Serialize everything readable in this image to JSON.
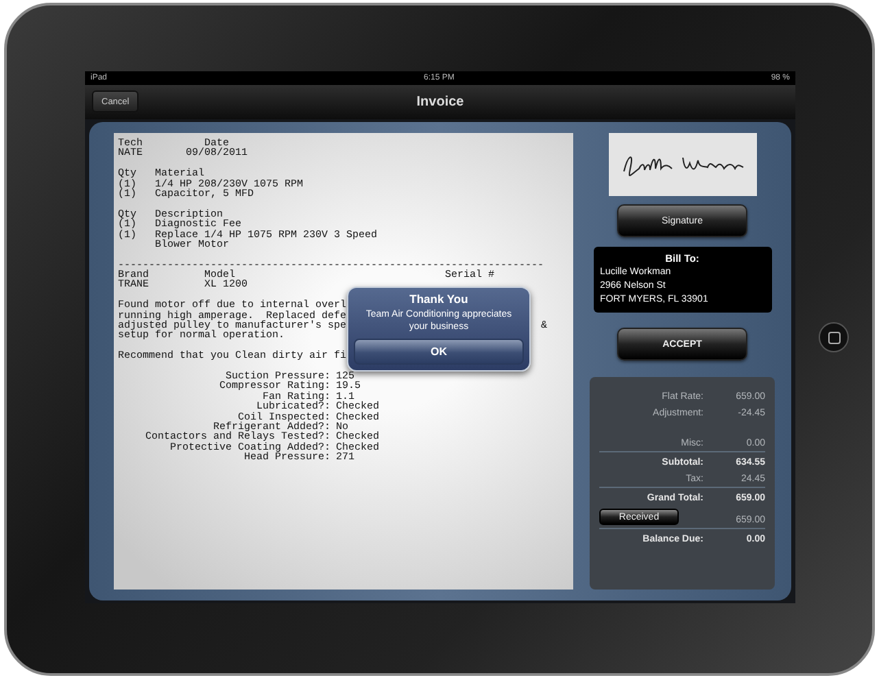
{
  "status_bar": {
    "device": "iPad",
    "time": "6:15 PM",
    "battery": "98 %"
  },
  "nav_bar": {
    "cancel": "Cancel",
    "title": "Invoice"
  },
  "document": {
    "lines": [
      {
        "kind": "text",
        "text": "Tech          Date"
      },
      {
        "kind": "text",
        "text": "NATE       09/08/2011"
      },
      {
        "kind": "blank"
      },
      {
        "kind": "text",
        "text": "Qty   Material"
      },
      {
        "kind": "text",
        "text": "(1)   1/4 HP 208/230V 1075 RPM"
      },
      {
        "kind": "text",
        "text": "(1)   Capacitor, 5 MFD"
      },
      {
        "kind": "blank"
      },
      {
        "kind": "text",
        "text": "Qty   Description"
      },
      {
        "kind": "text",
        "text": "(1)   Diagnostic Fee"
      },
      {
        "kind": "text",
        "text": "(1)   Replace 1/4 HP 1075 RPM 230V 3 Speed"
      },
      {
        "kind": "text",
        "text": "      Blower Motor"
      },
      {
        "kind": "blank"
      },
      {
        "kind": "rule",
        "text": "---------------------------------------------------------------------"
      },
      {
        "kind": "text",
        "text": "Brand         Model                                  Serial #"
      },
      {
        "kind": "text",
        "text": "TRANE         XL 1200"
      },
      {
        "kind": "blank"
      },
      {
        "kind": "text",
        "text": "Found motor off due to internal overl"
      },
      {
        "kind": "text",
        "text": "running high amperage.  Replaced defe"
      },
      {
        "kind": "split",
        "text": "adjusted pulley to manufacturer's spe",
        "tail": "&"
      },
      {
        "kind": "text",
        "text": "setup for normal operation."
      },
      {
        "kind": "blank"
      },
      {
        "kind": "text",
        "text": "Recommend that you Clean dirty air fi"
      },
      {
        "kind": "blank"
      },
      {
        "kind": "measure",
        "label": "Suction Pressure:",
        "value": "125"
      },
      {
        "kind": "measure",
        "label": "Compressor Rating:",
        "value": "19.5"
      },
      {
        "kind": "measure",
        "label": "Fan Rating:",
        "value": "1.1"
      },
      {
        "kind": "measure",
        "label": "Lubricated?:",
        "value": "Checked"
      },
      {
        "kind": "measure",
        "label": "Coil Inspected:",
        "value": "Checked"
      },
      {
        "kind": "measure",
        "label": "Refrigerant Added?:",
        "value": "No"
      },
      {
        "kind": "measure",
        "label": "Contactors and Relays Tested?:",
        "value": "Checked"
      },
      {
        "kind": "measure",
        "label": "Protective Coating Added?:",
        "value": "Checked"
      },
      {
        "kind": "measure",
        "label": "Head Pressure:",
        "value": "271"
      }
    ]
  },
  "alert": {
    "title": "Thank You",
    "message": "Team Air Conditioning appreciates your business",
    "button": "OK"
  },
  "signature_button": "Signature",
  "bill_to": {
    "heading": "Bill To:",
    "lines": [
      "Lucille Workman",
      "2966 Nelson St",
      "FORT MYERS, FL 33901"
    ]
  },
  "accept_button": "ACCEPT",
  "totals": [
    {
      "kind": "plain",
      "label": "Flat Rate:",
      "value": "659.00",
      "divider_before": false,
      "gap_before": false
    },
    {
      "kind": "plain",
      "label": "Adjustment:",
      "value": "-24.45",
      "divider_before": false,
      "gap_before": false
    },
    {
      "kind": "plain",
      "label": "Misc:",
      "value": "0.00",
      "divider_before": false,
      "gap_before": true
    },
    {
      "kind": "bold",
      "label": "Subtotal:",
      "value": "634.55",
      "divider_before": true,
      "gap_before": false
    },
    {
      "kind": "plain",
      "label": "Tax:",
      "value": "24.45",
      "divider_before": false,
      "gap_before": false
    },
    {
      "kind": "bold",
      "label": "Grand Total:",
      "value": "659.00",
      "divider_before": true,
      "gap_before": false
    },
    {
      "kind": "button",
      "label": "Received",
      "value": "659.00",
      "divider_before": false,
      "gap_before": false
    },
    {
      "kind": "bold",
      "label": "Balance Due:",
      "value": "0.00",
      "divider_before": true,
      "gap_before": false
    }
  ]
}
